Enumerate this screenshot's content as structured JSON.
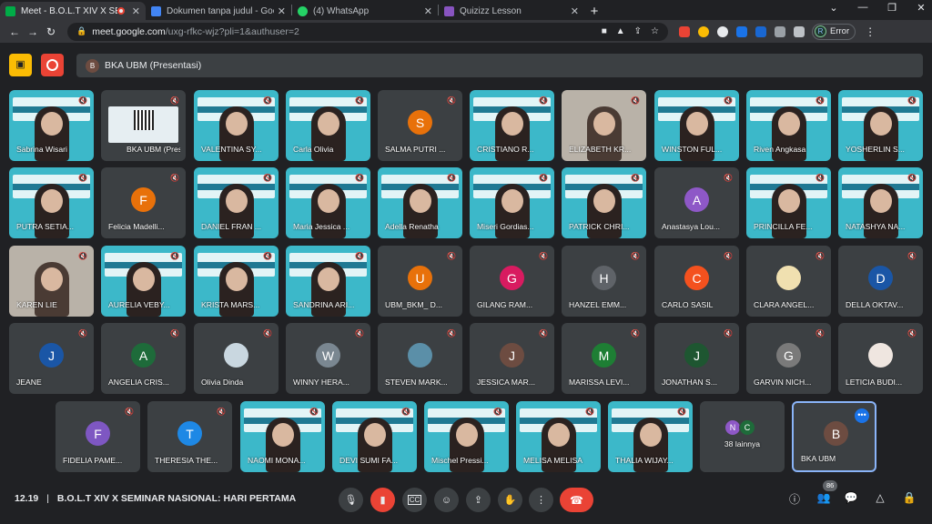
{
  "browser": {
    "tabs": [
      {
        "title": "Meet - B.O.L.T XIV X SEMINAR",
        "fav_color": "#00ac47",
        "active": true
      },
      {
        "title": "Dokumen tanpa judul - Google D",
        "fav_color": "#4285f4",
        "active": false
      },
      {
        "title": "(4) WhatsApp",
        "fav_color": "#25d366",
        "active": false
      },
      {
        "title": "Quizizz Lesson",
        "fav_color": "#8854c0",
        "active": false
      }
    ],
    "url_host": "meet.google.com",
    "url_path": "/uxg-rfkc-wjz?pli=1&authuser=2",
    "profile_initial": "R",
    "error_label": "Error"
  },
  "meet": {
    "presentation_initial": "B",
    "presentation_label": "BKA UBM (Presentasi)",
    "meeting_time": "12.19",
    "meeting_title": "B.O.L.T XIV X SEMINAR NASIONAL: HARI PERTAMA",
    "participant_count": "86",
    "others_label": "38 lainnya",
    "others_initials": [
      "N",
      "C"
    ],
    "participants": [
      {
        "name": "Sabrina Wisari",
        "kind": "video"
      },
      {
        "name": "BKA UBM (Presentasi)",
        "kind": "screen"
      },
      {
        "name": "VALENTINA SY...",
        "kind": "video"
      },
      {
        "name": "Carla Olivia",
        "kind": "video"
      },
      {
        "name": "SALMA PUTRI ...",
        "kind": "avatar",
        "initial": "S",
        "color": "#e8710a"
      },
      {
        "name": "CRISTIANO R...",
        "kind": "video"
      },
      {
        "name": "ELIZABETH KR...",
        "kind": "photo"
      },
      {
        "name": "WINSTON FUL...",
        "kind": "video"
      },
      {
        "name": "Riven Angkasa",
        "kind": "video"
      },
      {
        "name": "YOSHERLIN S...",
        "kind": "video"
      },
      {
        "name": "PUTRA SETIA...",
        "kind": "video"
      },
      {
        "name": "Felicia Madelli...",
        "kind": "avatar",
        "initial": "F",
        "color": "#e8710a"
      },
      {
        "name": "DANIEL FRAN ...",
        "kind": "video"
      },
      {
        "name": "Maria Jessica ...",
        "kind": "video"
      },
      {
        "name": "Adella Renatha",
        "kind": "video"
      },
      {
        "name": "Miseri Gordias...",
        "kind": "video"
      },
      {
        "name": "PATRICK CHRI...",
        "kind": "video"
      },
      {
        "name": "Anastasya Lou...",
        "kind": "avatar",
        "initial": "A",
        "color": "#8e58c7"
      },
      {
        "name": "PRINCILLA FE...",
        "kind": "video"
      },
      {
        "name": "NATASHYA NA...",
        "kind": "video"
      },
      {
        "name": "KAREN LIE",
        "kind": "photo"
      },
      {
        "name": "AURELIA VEBY...",
        "kind": "video"
      },
      {
        "name": "KRISTA MARS...",
        "kind": "video"
      },
      {
        "name": "SANDRINA ARI...",
        "kind": "video"
      },
      {
        "name": "UBM_BKM_ D...",
        "kind": "avatar",
        "initial": "U",
        "color": "#e8710a"
      },
      {
        "name": "GILANG RAM...",
        "kind": "avatar",
        "initial": "G",
        "color": "#d81b60"
      },
      {
        "name": "HANZEL EMM...",
        "kind": "avatar",
        "initial": "H",
        "color": "#5f6368"
      },
      {
        "name": "CARLO SASIL",
        "kind": "avatar",
        "initial": "C",
        "color": "#f4511e"
      },
      {
        "name": "CLARA ANGEL...",
        "kind": "avatar",
        "initial": "",
        "color": "#f0e0b0"
      },
      {
        "name": "DELLA OKTAV...",
        "kind": "avatar",
        "initial": "D",
        "color": "#1a56a6"
      },
      {
        "name": "JEANE",
        "kind": "avatar",
        "initial": "J",
        "color": "#1a56a6"
      },
      {
        "name": "ANGELIA CRIS...",
        "kind": "avatar",
        "initial": "A",
        "color": "#1e6b3a"
      },
      {
        "name": "Olivia Dinda",
        "kind": "avatar",
        "initial": "",
        "color": "#c9d7e0"
      },
      {
        "name": "WINNY HERA...",
        "kind": "avatar",
        "initial": "W",
        "color": "#7a8791"
      },
      {
        "name": "STEVEN MARK...",
        "kind": "avatar",
        "initial": "",
        "color": "#5b8fa8"
      },
      {
        "name": "JESSICA MAR...",
        "kind": "avatar",
        "initial": "J",
        "color": "#6d4c41"
      },
      {
        "name": "MARISSA LEVI...",
        "kind": "avatar",
        "initial": "M",
        "color": "#1e7e34"
      },
      {
        "name": "JONATHAN S...",
        "kind": "avatar",
        "initial": "J",
        "color": "#1e5631"
      },
      {
        "name": "GARVIN NICH...",
        "kind": "avatar",
        "initial": "G",
        "color": "#7a7a7a"
      },
      {
        "name": "LETICIA BUDI...",
        "kind": "avatar",
        "initial": "",
        "color": "#efe6e0"
      },
      {
        "name": "FIDELIA PAME...",
        "kind": "avatar",
        "initial": "F",
        "color": "#7e57c2"
      },
      {
        "name": "THERESIA THE...",
        "kind": "avatar",
        "initial": "T",
        "color": "#1e88e5"
      },
      {
        "name": "NAOMI MONA...",
        "kind": "video"
      },
      {
        "name": "DEVI SUMI FA...",
        "kind": "video"
      },
      {
        "name": "Mischel Pressi...",
        "kind": "video"
      },
      {
        "name": "MELISA MELISA",
        "kind": "video"
      },
      {
        "name": "THALIA WIJAY...",
        "kind": "video"
      }
    ],
    "self": {
      "name": "BKA UBM",
      "initial": "B",
      "color": "#6d4c41"
    }
  }
}
